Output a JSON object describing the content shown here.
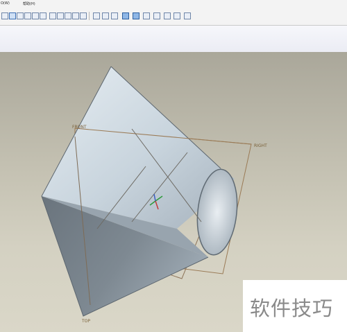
{
  "menu": {
    "item1": "O(W)",
    "item2": "帮助(H)"
  },
  "datum_planes": {
    "front": "FRONT",
    "right": "RIGHT",
    "top": "TOP"
  },
  "watermark": {
    "text": "软件技巧"
  },
  "colors": {
    "background_top": "#aaa79a",
    "background_bottom": "#dad7c8",
    "cone_light": "#d2dde5",
    "cone_shadow": "#6f7a84",
    "datum_line": "#9a7a55"
  },
  "toolbar_icons": [
    "view-icon",
    "orient-icon",
    "refit-icon",
    "zoom-in-icon",
    "zoom-out-icon",
    "repaint-icon",
    "saved-view-icon",
    "layers-icon",
    "wireframe-icon",
    "hidden-line-icon",
    "no-hidden-icon",
    "shading-icon",
    "datum-plane-icon",
    "datum-axis-icon",
    "datum-point-icon",
    "csys-icon",
    "spin-center-icon",
    "annotation-icon"
  ]
}
